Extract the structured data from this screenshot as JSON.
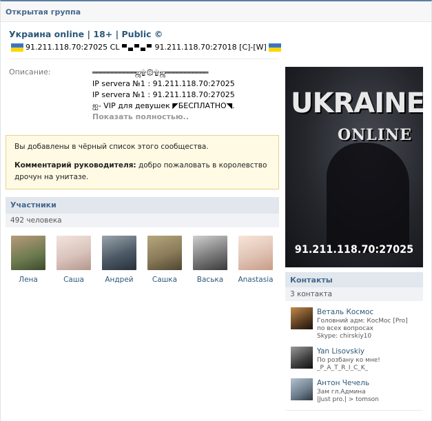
{
  "top_bar": {
    "label": "Открытая группа"
  },
  "header": {
    "title": "Украина online  |  18+  |  Public ©",
    "status_ip1": "91.211.118.70:27025 CL",
    "status_ip2": "91.211.118.70:27018 [C]-[W]"
  },
  "description": {
    "label": "Описание:",
    "lines": [
      "═══════════ஜ۩۞۩ஜ═══════════",
      "IP servera №1 : 91.211.118.70:27025",
      "IP servera №1 : 91.211.118.70:27025",
      "ஐ- VIP для девушек ◤БЕСПЛАТНО◥.",
      "Показать полностью.."
    ]
  },
  "notice": {
    "blacklist": "Вы добавлены в чёрный список этого сообщества.",
    "comment_label": "Комментарий руководителя:",
    "comment_text": " добро пожаловать в королевство дрочун на унитазе."
  },
  "members": {
    "header": "Участники",
    "count": "492 человека",
    "list": [
      {
        "name": "Лена",
        "color": "#6b7a4e"
      },
      {
        "name": "Саша",
        "color": "#d9c3bc"
      },
      {
        "name": "Андрей",
        "color": "#4d5a66"
      },
      {
        "name": "Сашка",
        "color": "#8a7b5a"
      },
      {
        "name": "Васька",
        "color": "#7b7b7b"
      },
      {
        "name": "Anastasia",
        "color": "#e0c2b4"
      }
    ]
  },
  "cover": {
    "title": "UKRAINE",
    "subtitle": "ONLINE",
    "ip": "91.211.118.70:27025"
  },
  "contacts": {
    "header": "Контакты",
    "count": "3 контакта",
    "list": [
      {
        "name": "Веталь Космос",
        "role_lines": [
          "Головний адм: КосМос [Pro]",
          "по всех вопросах",
          "Skype: chirskiy10"
        ],
        "color": "#5a3d22"
      },
      {
        "name": "Yan Lisovskiy",
        "role_lines": [
          "По розбану ко мне!",
          "_P_A_T_R_I_C_K_"
        ],
        "color": "#3e3e3e"
      },
      {
        "name": "Антон Чечель",
        "role_lines": [
          "Зам гл.Админа",
          "|Just pro.| > tomson"
        ],
        "color": "#6c7b8a"
      }
    ]
  }
}
